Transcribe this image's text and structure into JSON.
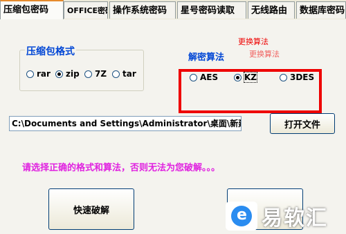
{
  "tabs": [
    {
      "label": "压缩包密码",
      "active": true
    },
    {
      "label": "OFFICE密码",
      "active": false
    },
    {
      "label": "操作系统密码",
      "active": false
    },
    {
      "label": "星号密码读取",
      "active": false
    },
    {
      "label": "无线路由",
      "active": false
    },
    {
      "label": "数据库密码",
      "active": false
    }
  ],
  "format_group": {
    "label": "压缩包格式",
    "options": [
      "rar",
      "zip",
      "7Z",
      "tar"
    ],
    "selected": "zip"
  },
  "algorithm_group": {
    "label": "解密算法",
    "options": [
      "AES",
      "KZ",
      "3DES"
    ],
    "selected": "KZ"
  },
  "annotation": {
    "line1": "更换算法",
    "line2": "更换算法"
  },
  "path": {
    "value": "C:\\Documents and Settings\\Administrator\\桌面\\新建文件夹"
  },
  "open_button": {
    "label": "打开文件"
  },
  "warning": {
    "text": "请选择正确的格式和算法，否则无法为您破解。。。"
  },
  "crack_button": {
    "label": "快速破解"
  },
  "watermark": {
    "text": "易软汇"
  },
  "colors": {
    "highlight_red": "#ee0000",
    "warning_magenta": "#e022e0",
    "group_blue": "#0046d5"
  }
}
